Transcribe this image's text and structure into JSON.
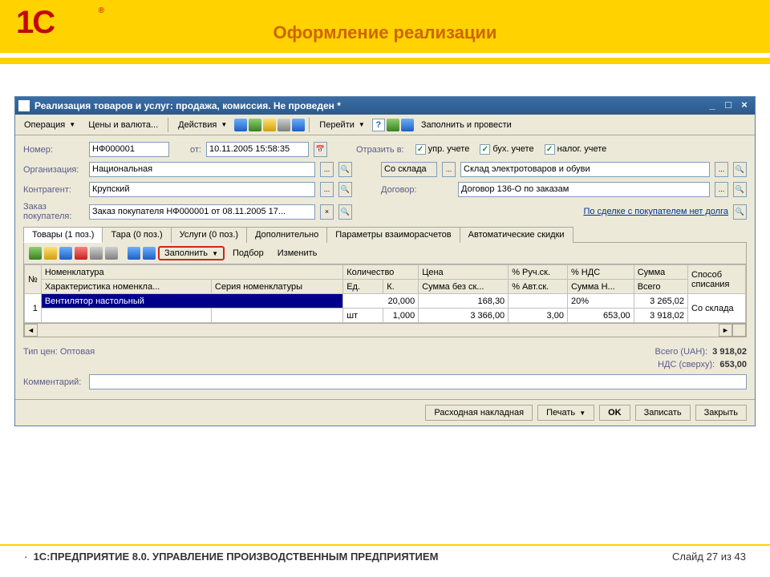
{
  "slide": {
    "title": "Оформление реализации",
    "product": "1С:ПРЕДПРИЯТИЕ 8.0. УПРАВЛЕНИЕ ПРОИЗВОДСТВЕННЫМ ПРЕДПРИЯТИЕМ",
    "footer": "Слайд 27 из 43",
    "logo": "1С"
  },
  "window": {
    "title": "Реализация товаров и услуг: продажа, комиссия. Не проведен *"
  },
  "toolbar": {
    "operation": "Операция",
    "prices": "Цены и валюта...",
    "actions": "Действия",
    "go": "Перейти",
    "fill_post": "Заполнить и провести"
  },
  "form": {
    "number_label": "Номер:",
    "number": "НФ000001",
    "from_label": "от:",
    "from": "10.11.2005 15:58:35",
    "reflect_label": "Отразить в:",
    "chk_mgmt": "упр. учете",
    "chk_acct": "бух. учете",
    "chk_tax": "налог. учете",
    "org_label": "Организация:",
    "org": "Национальная",
    "from_wh_label": "Со склада",
    "warehouse": "Склад электротоваров и обуви",
    "contr_label": "Контрагент:",
    "contr": "Крупский",
    "contract_label": "Договор:",
    "contract": "Договор 136-О по заказам",
    "order_label": "Заказ покупателя:",
    "order": "Заказ покупателя НФ000001 от 08.11.2005 17...",
    "deal_link": "По сделке с покупателем нет долга"
  },
  "tabs": {
    "t0": "Товары (1 поз.)",
    "t1": "Тара (0 поз.)",
    "t2": "Услуги (0 поз.)",
    "t3": "Дополнительно",
    "t4": "Параметры взаиморасчетов",
    "t5": "Автоматические скидки"
  },
  "table_toolbar": {
    "fill": "Заполнить",
    "select": "Подбор",
    "change": "Изменить"
  },
  "cols": {
    "num": "№",
    "nomen": "Номенклатура",
    "char": "Характеристика номенкла...",
    "series": "Серия номенклатуры",
    "qty": "Количество",
    "unit": "Ед.",
    "k": "К.",
    "price": "Цена",
    "sum_wo": "Сумма без ск...",
    "man_disc": "% Руч.ск.",
    "auto_disc": "% Авт.ск.",
    "vat_pct": "% НДС",
    "vat_sum": "Сумма Н...",
    "total": "Сумма",
    "grand": "Всего",
    "method": "Способ списания"
  },
  "rows": {
    "r1_num": "1",
    "r1_nomen": "Вентилятор настольный",
    "r1_qty": "20,000",
    "r1_price": "168,30",
    "r1_vat_pct": "20%",
    "r1_total": "3 265,02",
    "r1_method": "Со склада",
    "r2_unit": "шт",
    "r2_k": "1,000",
    "r2_sum_wo": "3 366,00",
    "r2_auto": "3,00",
    "r2_vat_sum": "653,00",
    "r2_grand": "3 918,02"
  },
  "totals": {
    "price_type_label": "Тип цен: Оптовая",
    "total_label": "Всего (UAH):",
    "total_val": "3 918,02",
    "vat_label": "НДС (сверху):",
    "vat_val": "653,00"
  },
  "comment_label": "Комментарий:",
  "buttons": {
    "invoice": "Расходная накладная",
    "print": "Печать",
    "ok": "OK",
    "save": "Записать",
    "close": "Закрыть"
  }
}
